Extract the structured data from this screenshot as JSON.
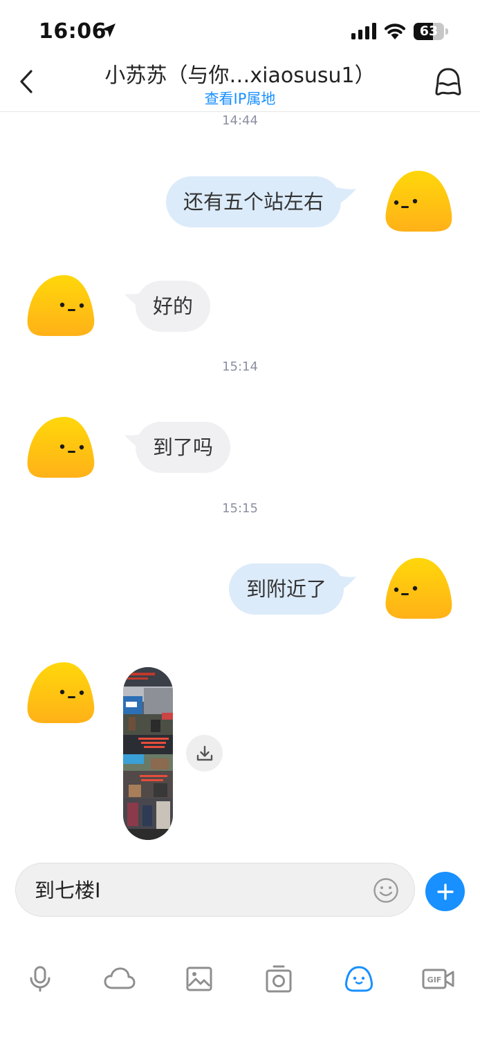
{
  "status_bar": {
    "time": "16:06",
    "battery": "63",
    "battery_level": 0.63
  },
  "header": {
    "title": "小苏苏（与你…xiaosusu1）",
    "subtitle": "查看IP属地"
  },
  "messages": [
    {
      "type": "timestamp",
      "text": "14:44"
    },
    {
      "type": "text",
      "direction": "outgoing",
      "text": "还有五个站左右"
    },
    {
      "type": "text",
      "direction": "incoming",
      "text": "好的"
    },
    {
      "type": "timestamp",
      "text": "15:14"
    },
    {
      "type": "text",
      "direction": "incoming",
      "text": "到了吗"
    },
    {
      "type": "timestamp",
      "text": "15:15"
    },
    {
      "type": "text",
      "direction": "outgoing",
      "text": "到附近了"
    },
    {
      "type": "image",
      "direction": "incoming"
    }
  ],
  "input": {
    "value": "到七楼I"
  },
  "toolbar": {
    "items": [
      "microphone-icon",
      "cloud-icon",
      "image-icon",
      "camera-icon",
      "emoji-face-icon",
      "gif-video-icon"
    ],
    "active": "emoji-face-icon",
    "active_color": "#1890ff",
    "inactive_color": "#8e8e8e"
  },
  "colors": {
    "accent": "#1890ff",
    "outgoing_bubble": "#dcebfa",
    "incoming_bubble": "#f0f0f2"
  }
}
